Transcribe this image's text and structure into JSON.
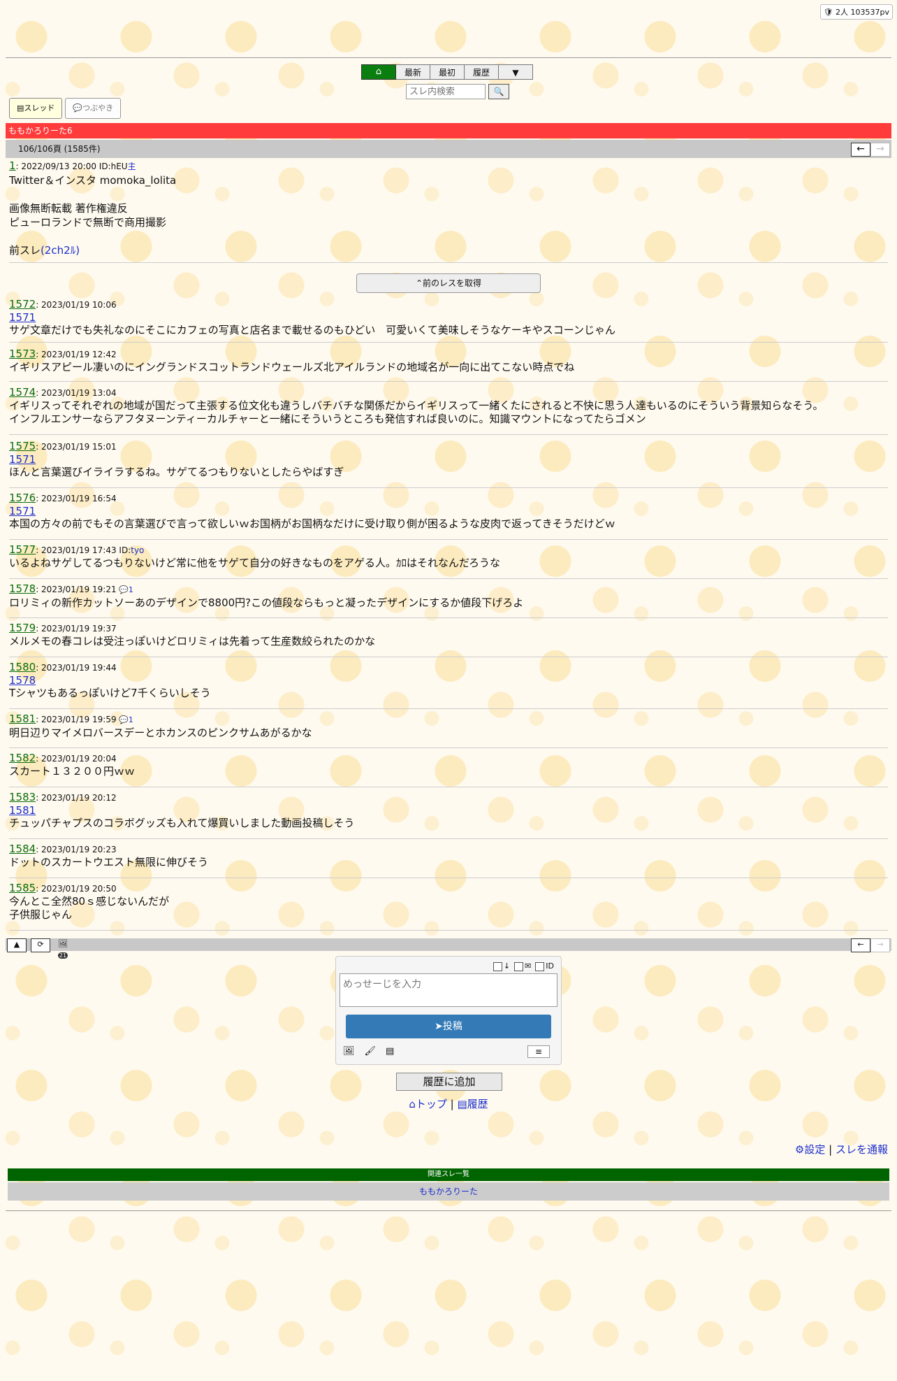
{
  "pv": "2人 103537pv",
  "nav": {
    "home_icon": "home-icon",
    "latest": "最新",
    "first": "最初",
    "history": "履歴",
    "more": "▼"
  },
  "search": {
    "placeholder": "スレ内検索",
    "button_icon": "search-icon"
  },
  "tabs": {
    "thread": "スレッド",
    "murmur": "つぶやき"
  },
  "thread": {
    "title": "ももかろりーた6",
    "page_info": "106/106頁 (1585件)"
  },
  "op": {
    "num": "1",
    "meta": ": 2022/09/13 20:00 ID:hEU",
    "owner_mark": "主",
    "body": "Twitter＆インスタ momoka_lolita\n\n画像無断転載 著作権違反\nピューロランドで無断で商用撮影\n\n前スレ",
    "prev_link": "(2ch2ﾙ)"
  },
  "prev_button": "前のレスを取得",
  "posts": [
    {
      "num": "1572",
      "meta": ": 2023/01/19 10:06",
      "reply": "1571",
      "body": "サゲ文章だけでも失礼なのにそこにカフェの写真と店名まで載せるのもひどい　可愛いくて美味しそうなケーキやスコーンじゃん"
    },
    {
      "num": "1573",
      "meta": ": 2023/01/19 12:42",
      "reply": "",
      "body": "イギリスアピール凄いのにイングランドスコットランドウェールズ北アイルランドの地域名が一向に出てこない時点でね"
    },
    {
      "num": "1574",
      "meta": ": 2023/01/19 13:04",
      "reply": "",
      "body": "イギリスってそれぞれの地域が国だって主張する位文化も違うしバチバチな関係だからイギリスって一緒くたにされると不快に思う人達もいるのにそういう背景知らなそう。\nインフルエンサーならアフタヌーンティーカルチャーと一緒にそういうところも発信すれば良いのに。知識マウントになってたらゴメン"
    },
    {
      "num": "1575",
      "meta": ": 2023/01/19 15:01",
      "reply": "1571",
      "body": "ほんと言葉選びイライラするね。サゲてるつもりないとしたらやばすぎ"
    },
    {
      "num": "1576",
      "meta": ": 2023/01/19 16:54",
      "reply": "1571",
      "body": "本国の方々の前でもその言葉選びで言って欲しいｗお国柄がお国柄なだけに受け取り側が困るような皮肉で返ってきそうだけどｗ"
    },
    {
      "num": "1577",
      "meta": ": 2023/01/19 17:43 ID:",
      "id_link": "tyo",
      "reply": "",
      "body": "いるよねサゲしてるつもりないけど常に他をサゲて自分の好きなものをアゲる人。ｶﾛはそれなんだろうな"
    },
    {
      "num": "1578",
      "meta": ": 2023/01/19 19:21",
      "badge": "1",
      "reply": "",
      "body": "ロリミィの新作カットソーあのデザインで8800円?この値段ならもっと凝ったデザインにするか値段下げろよ"
    },
    {
      "num": "1579",
      "meta": ": 2023/01/19 19:37",
      "reply": "",
      "body": "メルメモの春コレは受注っぽいけどロリミィは先着って生産数絞られたのかな"
    },
    {
      "num": "1580",
      "meta": ": 2023/01/19 19:44",
      "reply": "1578",
      "body": "Tシャツもあるっぽいけど7千くらいしそう"
    },
    {
      "num": "1581",
      "meta": ": 2023/01/19 19:59",
      "badge": "1",
      "reply": "",
      "body": "明日辺りマイメロバースデーとホカンスのピンクサムあがるかな"
    },
    {
      "num": "1582",
      "meta": ": 2023/01/19 20:04",
      "reply": "",
      "body": "スカート１３２００円ｗｗ"
    },
    {
      "num": "1583",
      "meta": ": 2023/01/19 20:12",
      "reply": "1581",
      "body": "チュッパチャプスのコラボグッズも入れて爆買いしました動画投稿しそう"
    },
    {
      "num": "1584",
      "meta": ": 2023/01/19 20:23",
      "reply": "",
      "body": "ドットのスカートウエスト無限に伸びそう"
    },
    {
      "num": "1585",
      "meta": ": 2023/01/19 20:50",
      "reply": "",
      "body": "今んとこ全然80ｓ感じないんだが\n子供服じゃん"
    }
  ],
  "bottom": {
    "top_btn": "▲",
    "reload_icon": "reload-icon",
    "images_icon": "images-icon",
    "images_count": "21"
  },
  "form": {
    "opt_id": "ID",
    "placeholder": "めっせーじを入力",
    "submit": "投稿",
    "menu": "≡"
  },
  "history_add": "履歴に追加",
  "links": {
    "top": "トップ",
    "sep": "|",
    "history": "履歴"
  },
  "footer": {
    "settings": "設定",
    "sep": "|",
    "report": "スレを通報"
  },
  "related": {
    "heading": "関連スレ一覧",
    "item": "ももかろりーた"
  },
  "colors": {
    "title_bar": "#ff3b3b",
    "home": "#0a7f10",
    "submit": "#337ab7",
    "related_head": "#006400"
  }
}
